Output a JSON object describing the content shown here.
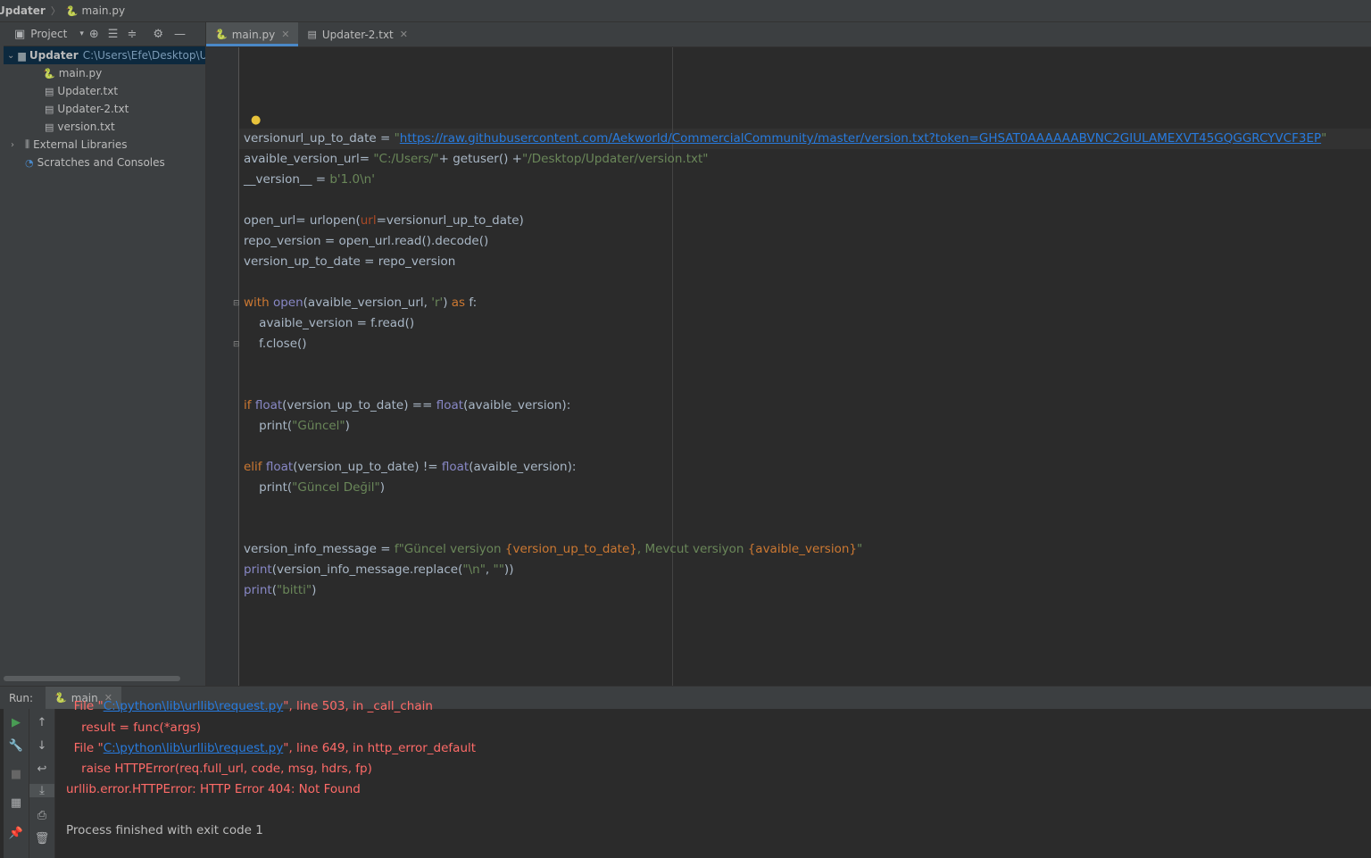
{
  "breadcrumb": {
    "project": "Updater",
    "file": "main.py"
  },
  "project_panel": {
    "title": "Project",
    "tree": [
      {
        "label": "Updater",
        "path": "C:\\Users\\Efe\\Desktop\\Up",
        "type": "folder"
      },
      {
        "label": "main.py",
        "type": "py"
      },
      {
        "label": "Updater.txt",
        "type": "txt"
      },
      {
        "label": "Updater-2.txt",
        "type": "txt"
      },
      {
        "label": "version.txt",
        "type": "txt"
      },
      {
        "label": "External Libraries",
        "type": "lib"
      },
      {
        "label": "Scratches and Consoles",
        "type": "scratch"
      }
    ]
  },
  "tabs": [
    {
      "label": "main.py",
      "active": true
    },
    {
      "label": "Updater-2.txt",
      "active": false
    }
  ],
  "code": {
    "l1_var": "versionurl_up_to_date = ",
    "l1_url": "https://raw.githubusercontent.com/Aekworld/CommercialCommunity/master/version.txt?token=GHSAT0AAAAAABVNC2GIULAMEXVT45GQGGRCYVCF3EP",
    "l2_var": "avaible_version_url= ",
    "l2_s1": "\"C:/Users/\"",
    "l2_mid": "+ getuser() +",
    "l2_s2": "\"/Desktop/Updater/version.txt\"",
    "l3_var": "__version__ = ",
    "l3_val": "b'1.0\\n'",
    "l5_a": "open_url= urlopen(",
    "l5_prm": "url",
    "l5_b": "=versionurl_up_to_date)",
    "l6": "repo_version = open_url.read().decode()",
    "l7": "version_up_to_date = repo_version",
    "l9_kw": "with",
    "l9_bi": "open",
    "l9_a": "(avaible_version_url, ",
    "l9_s": "'r'",
    "l9_b": ") ",
    "l9_as": "as",
    "l9_c": " f:",
    "l10": "    avaible_version = f.read()",
    "l11": "    f.close()",
    "l14_kw": "if",
    "l14_bi1": "float",
    "l14_a": "(version_up_to_date) == ",
    "l14_bi2": "float",
    "l14_b": "(avaible_version):",
    "l15_a": "    print(",
    "l15_s": "\"Güncel\"",
    "l15_b": ")",
    "l17_kw": "elif",
    "l17_bi1": "float",
    "l17_a": "(version_up_to_date) != ",
    "l17_bi2": "float",
    "l17_b": "(avaible_version):",
    "l18_a": "    print(",
    "l18_s": "\"Güncel Değil\"",
    "l18_b": ")",
    "l21_a": "version_info_message = ",
    "l21_s1": "f\"Güncel versiyon ",
    "l21_v1": "{version_up_to_date}",
    "l21_s2": ", Mevcut versiyon ",
    "l21_v2": "{avaible_version}",
    "l21_s3": "\"",
    "l22_bi": "print",
    "l22_a": "(version_info_message.replace(",
    "l22_s1": "\"\\n\"",
    "l22_b": ", ",
    "l22_s2": "\"\"",
    "l22_c": "))",
    "l23_bi": "print",
    "l23_a": "(",
    "l23_s": "\"bitti\"",
    "l23_b": ")"
  },
  "run": {
    "label": "Run:",
    "tab": "main",
    "lines": {
      "c0_a": "  File \"",
      "c0_lnk": "C:\\python\\lib\\urllib\\request.py",
      "c0_b": "\", line 503, in _call_chain",
      "c1": "    result = func(*args)",
      "c2_a": "  File \"",
      "c2_lnk": "C:\\python\\lib\\urllib\\request.py",
      "c2_b": "\", line 649, in http_error_default",
      "c3": "    raise HTTPError(req.full_url, code, msg, hdrs, fp)",
      "c4": "urllib.error.HTTPError: HTTP Error 404: Not Found",
      "c6": "Process finished with exit code 1"
    }
  }
}
